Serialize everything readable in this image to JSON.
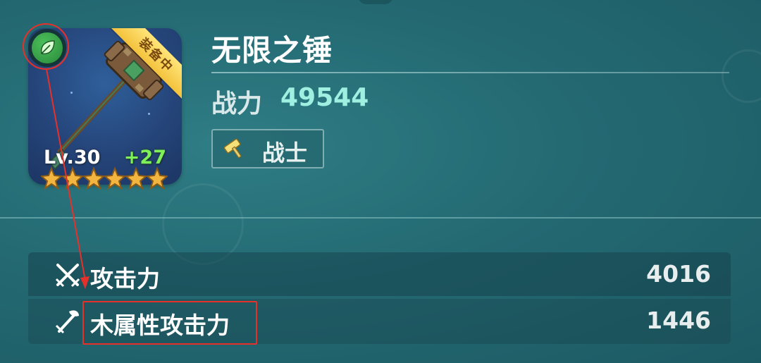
{
  "item": {
    "name": "无限之锤",
    "power_label": "战力",
    "power_value": "49544",
    "class_label": "战士",
    "class_icon": "hammer-icon",
    "element_icon": "leaf-icon",
    "equipped_badge": "装备中",
    "level": "Lv.30",
    "enhance": "+27",
    "stars": 6
  },
  "stats": [
    {
      "icon": "crossed-swords-icon",
      "label": "攻击力",
      "value": "4016"
    },
    {
      "icon": "wood-sword-icon",
      "label": "木属性攻击力",
      "value": "1446"
    }
  ],
  "colors": {
    "background": "#246a73",
    "power_value": "#9ff0e0",
    "enhance": "#7ef05a",
    "highlight": "#e8302a",
    "badge": "#f3c23c"
  }
}
